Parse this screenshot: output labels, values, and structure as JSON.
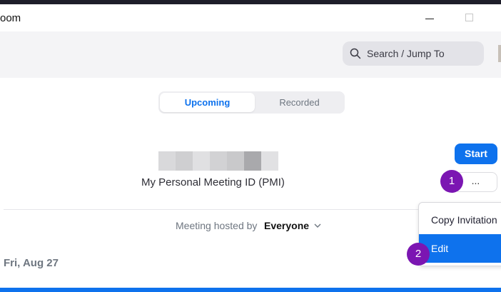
{
  "app": {
    "title": "oom"
  },
  "search": {
    "placeholder": "Search / Jump To"
  },
  "tabs": [
    {
      "label": "Upcoming",
      "active": true
    },
    {
      "label": "Recorded",
      "active": false
    }
  ],
  "pmi": {
    "label": "My Personal Meeting ID (PMI)",
    "blurred_colors": [
      "#d9d9db",
      "#cfcfd1",
      "#e0e0e2",
      "#d2d2d4",
      "#c9c9cb",
      "#a9a9ac",
      "#e1e1e3"
    ]
  },
  "actions": {
    "start_label": "Start",
    "more_label": "..."
  },
  "filter": {
    "label": "Meeting hosted by",
    "value": "Everyone"
  },
  "date_group": {
    "label": "Fri, Aug 27"
  },
  "context_menu": {
    "items": [
      {
        "label": "Copy Invitation"
      },
      {
        "label": "Edit",
        "highlighted": true
      }
    ]
  },
  "badges": [
    "1",
    "2"
  ],
  "colors": {
    "accent": "#0e72ed",
    "badge": "#7b16b2"
  }
}
